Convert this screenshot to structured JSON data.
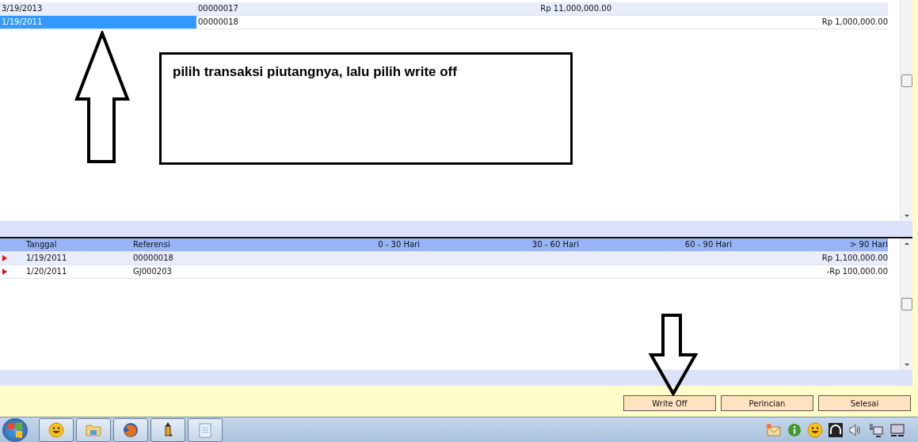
{
  "top_grid": {
    "rows": [
      {
        "date": "3/19/2013",
        "reference": "00000017",
        "column_3": "Rp 11,000,000.00",
        "column_4": "",
        "selected": false
      },
      {
        "date": "1/19/2011",
        "reference": "00000018",
        "column_3": "",
        "column_4": "Rp 1,000,000.00",
        "selected": true
      }
    ]
  },
  "annotation": {
    "text": "pilih transaksi piutangnya, lalu pilih write off"
  },
  "aging_grid": {
    "columns": [
      "Tanggal",
      "Referensi",
      "0 - 30 Hari",
      "30 - 60 Hari",
      "60 - 90 Hari",
      "> 90 Hari"
    ],
    "rows": [
      {
        "date": "1/19/2011",
        "reference": "00000018",
        "over_90": "Rp 1,100,000.00"
      },
      {
        "date": "1/20/2011",
        "reference": "GJ000203",
        "over_90": "-Rp 100,000.00"
      }
    ]
  },
  "buttons": [
    {
      "label": "Write Off"
    },
    {
      "label": "Perincian"
    },
    {
      "label": "Selesai"
    }
  ],
  "taskbar": {
    "apps": [
      {
        "kind": "smiley"
      },
      {
        "kind": "folder"
      },
      {
        "kind": "browser"
      },
      {
        "kind": "pencil"
      },
      {
        "kind": "notepad"
      }
    ],
    "tray": [
      {
        "kind": "mail"
      },
      {
        "kind": "info"
      },
      {
        "kind": "smiley"
      },
      {
        "kind": "headphones"
      },
      {
        "kind": "speaker"
      },
      {
        "kind": "network"
      },
      {
        "kind": "monitor"
      }
    ]
  }
}
